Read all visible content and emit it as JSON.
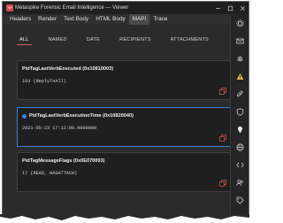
{
  "window": {
    "title": "Metaspike Forensic Email Intelligence — Viewer",
    "controls": [
      "minimize-icon",
      "maximize-icon",
      "close-icon"
    ]
  },
  "menu": {
    "items": [
      {
        "label": "Headers"
      },
      {
        "label": "Render"
      },
      {
        "label": "Text Body"
      },
      {
        "label": "HTML Body"
      },
      {
        "label": "MAPI"
      },
      {
        "label": "Trace"
      }
    ],
    "active_label": "MAPI"
  },
  "tabs": [
    {
      "label": "ALL"
    },
    {
      "label": "NAMED"
    },
    {
      "label": "DATE"
    },
    {
      "label": "RECIPIENTS"
    },
    {
      "label": "ATTACHMENTS"
    }
  ],
  "active_tab": "ALL",
  "properties": [
    {
      "title": "PidTagLastVerbExecuted (0x10810003)",
      "value": "103 (ReplyToAll)"
    },
    {
      "title": "PidTagLastVerbExecutionTime (0x10820040)",
      "value": "2021-05-23 17:12:00.0000000"
    },
    {
      "title": "PidTagMessageFlags (0x0E070003)",
      "value": "17 (READ, HASATTACH)"
    }
  ],
  "sidebar_icons": [
    "gear-icon",
    "envelope-icon",
    "fingerprint-icon",
    "warning-icon",
    "paperclip-icon",
    "shield-icon",
    "lightbulb-icon",
    "globe-icon",
    "code-icon",
    "people-icon",
    "tag-icon"
  ],
  "colors": {
    "accent_blue": "#3f7ed8",
    "accent_red": "#e05a5a",
    "warning": "#e2b93b"
  }
}
